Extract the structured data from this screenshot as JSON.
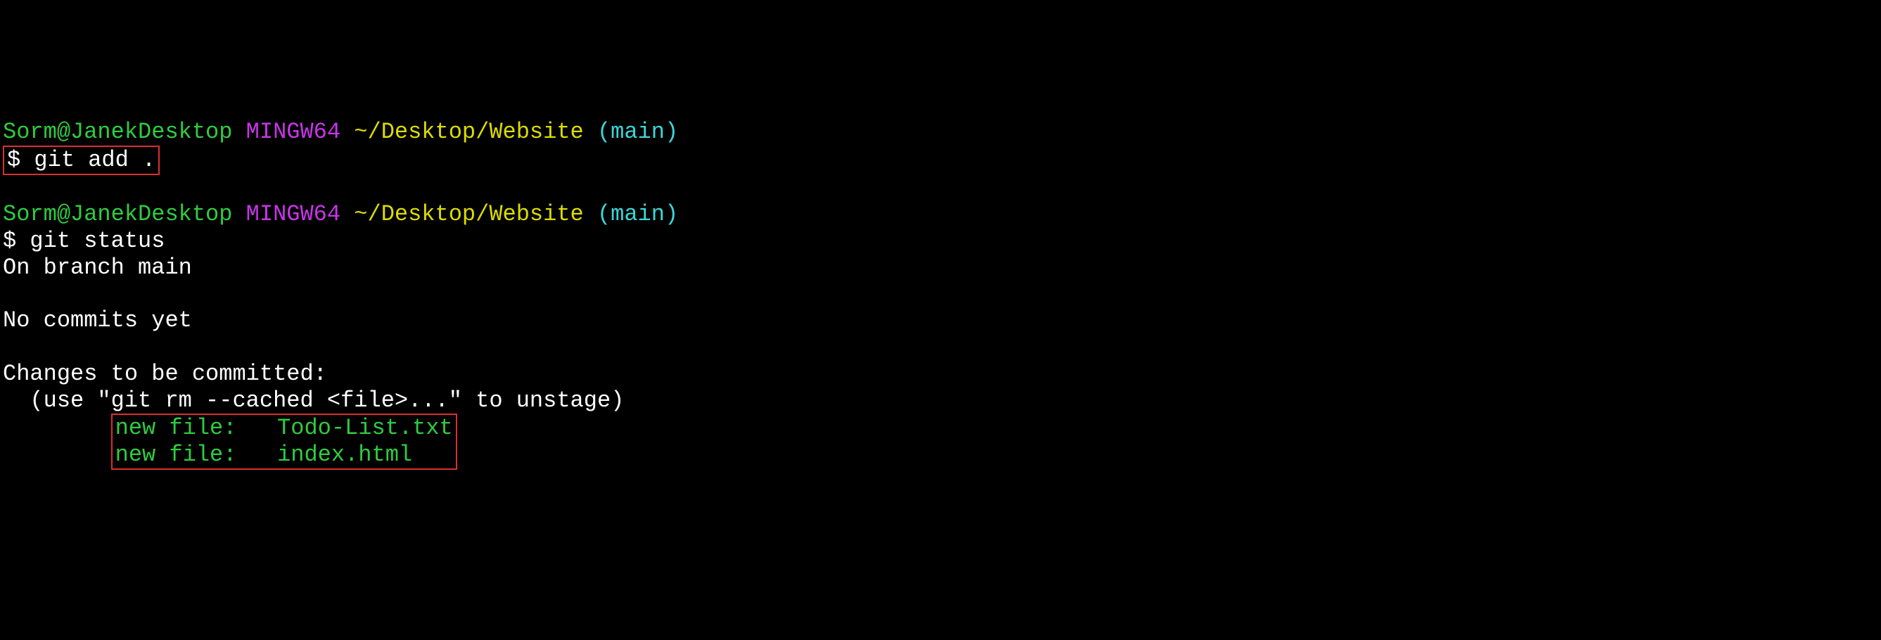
{
  "prompt1": {
    "user": "Sorm@JanekDesktop",
    "mingw": "MINGW64",
    "path": "~/Desktop/Website",
    "branch": "(main)"
  },
  "command1": {
    "prefix": "$ ",
    "command": "git add ."
  },
  "prompt2": {
    "user": "Sorm@JanekDesktop",
    "mingw": "MINGW64",
    "path": "~/Desktop/Website",
    "branch": "(main)"
  },
  "command2": {
    "prefix": "$ ",
    "command": "git status"
  },
  "output": {
    "branch_info": "On branch main",
    "commits_info": "No commits yet",
    "changes_header": "Changes to be committed:",
    "unstage_hint": "  (use \"git rm --cached <file>...\" to unstage)",
    "files": [
      "new file:   Todo-List.txt",
      "new file:   index.html"
    ]
  }
}
